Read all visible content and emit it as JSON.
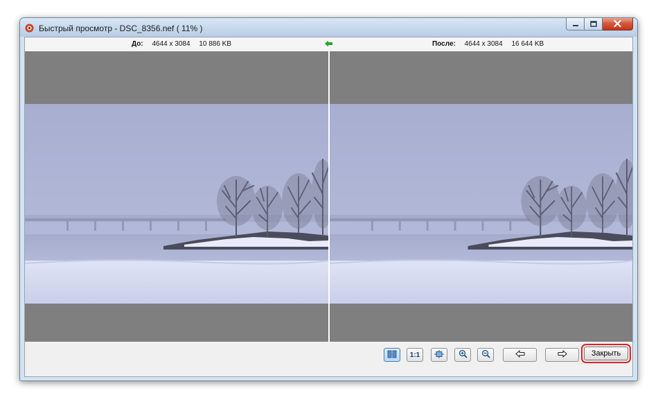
{
  "window": {
    "title": "Быстрый просмотр - DSC_8356.nef  ( 11% )"
  },
  "icons": {
    "app": "app-icon",
    "minimize": "minimize-icon",
    "maximize": "maximize-icon",
    "close": "close-icon",
    "swap": "arrow-left-icon"
  },
  "info_bar": {
    "before": {
      "label": "До:",
      "dimensions": "4644 x 3084",
      "size": "10 886 KB"
    },
    "after": {
      "label": "После:",
      "dimensions": "4644 x 3084",
      "size": "16 644 KB"
    }
  },
  "toolbar": {
    "compare_icon": "side-by-side-icon",
    "actual_size_label": "1:1",
    "fit_icon": "fit-to-window-icon",
    "zoom_in_icon": "zoom-in-icon",
    "zoom_out_icon": "zoom-out-icon",
    "prev_icon": "arrow-left-icon",
    "next_icon": "arrow-right-icon",
    "close_label": "Закрыть"
  },
  "colors": {
    "highlight": "#e02020",
    "swap_arrow": "#2aa52a",
    "pane_background": "#7f7f7f"
  }
}
